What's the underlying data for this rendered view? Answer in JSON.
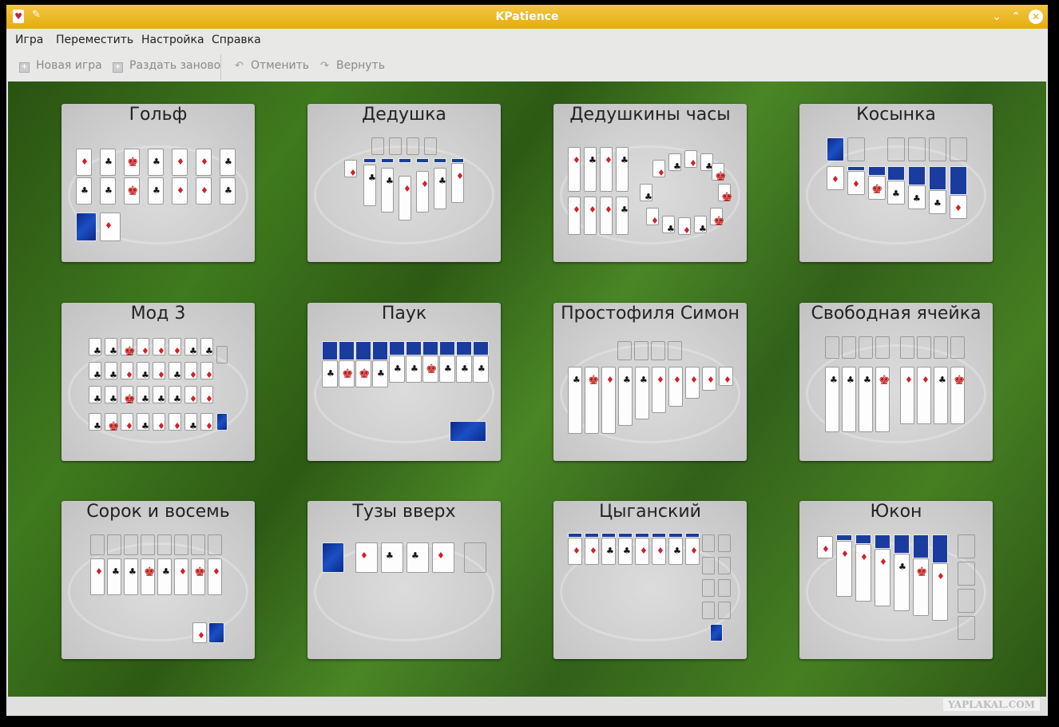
{
  "window": {
    "title": "KPatience"
  },
  "menu": [
    "Игра",
    "Переместить",
    "Настройка",
    "Справка"
  ],
  "toolbar": {
    "new_game": "Новая игра",
    "redeal": "Раздать заново",
    "undo": "Отменить",
    "redo": "Вернуть"
  },
  "games": [
    "Гольф",
    "Дедушка",
    "Дедушкины часы",
    "Косынка",
    "Мод 3",
    "Паук",
    "Простофиля Симон",
    "Свободная ячейка",
    "Сорок и восемь",
    "Тузы вверх",
    "Цыганский",
    "Юкон"
  ],
  "watermark": "YAPLAKAL.COM",
  "colors": {
    "titlebar": "#e4ac0e",
    "felt": "#3a6e1c"
  }
}
